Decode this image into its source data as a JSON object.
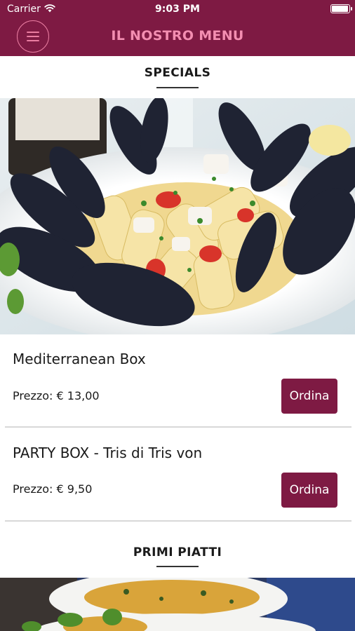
{
  "status_bar": {
    "carrier": "Carrier",
    "time": "9:03 PM",
    "battery_level": 1.0
  },
  "header": {
    "title": "IL NOSTRO MENU",
    "menu_icon": "hamburger-menu-icon",
    "background_color": "#7e1a43",
    "title_color": "#f38eb1"
  },
  "sections": [
    {
      "title": "SPECIALS",
      "image": "pasta-with-mussels-photo",
      "items": [
        {
          "name": "Mediterranean Box",
          "price_label": "Prezzo: € 13,00",
          "button_label": "Ordina"
        },
        {
          "name": "PARTY BOX - Tris di Tris von",
          "price_label": "Prezzo: € 9,50",
          "button_label": "Ordina"
        }
      ]
    },
    {
      "title": "PRIMI PIATTI",
      "image": "pasta-dishes-photo"
    }
  ],
  "accent_color": "#7e1a43"
}
